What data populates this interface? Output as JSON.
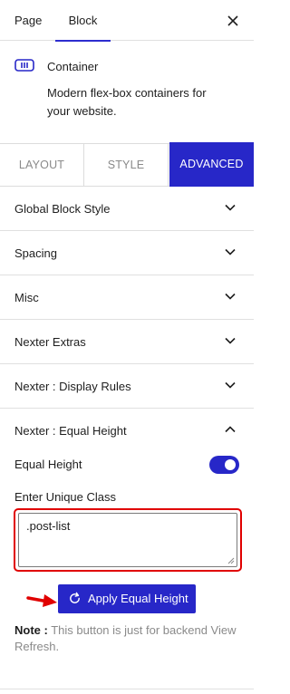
{
  "header": {
    "tabs": [
      {
        "label": "Page"
      },
      {
        "label": "Block"
      }
    ],
    "close_icon": "close-icon"
  },
  "block_card": {
    "icon": "container-icon",
    "name": "Container",
    "description": "Modern flex-box containers for your website."
  },
  "style_tabs": [
    {
      "label": "LAYOUT"
    },
    {
      "label": "STYLE"
    },
    {
      "label": "ADVANCED"
    }
  ],
  "panels": [
    {
      "title": "Global Block Style"
    },
    {
      "title": "Spacing"
    },
    {
      "title": "Misc"
    },
    {
      "title": "Nexter Extras"
    },
    {
      "title": "Nexter : Display Rules"
    }
  ],
  "equal_height": {
    "title": "Nexter : Equal Height",
    "toggle_label": "Equal Height",
    "toggle_on": true,
    "unique_class_label": "Enter Unique Class",
    "unique_class_value": ".post-list",
    "button_label": "Apply Equal Height",
    "button_icon": "refresh-icon",
    "note_strong": "Note :",
    "note_text": " This button is just for backend View Refresh."
  },
  "colors": {
    "accent": "#2727c8",
    "highlight": "#e00000"
  }
}
